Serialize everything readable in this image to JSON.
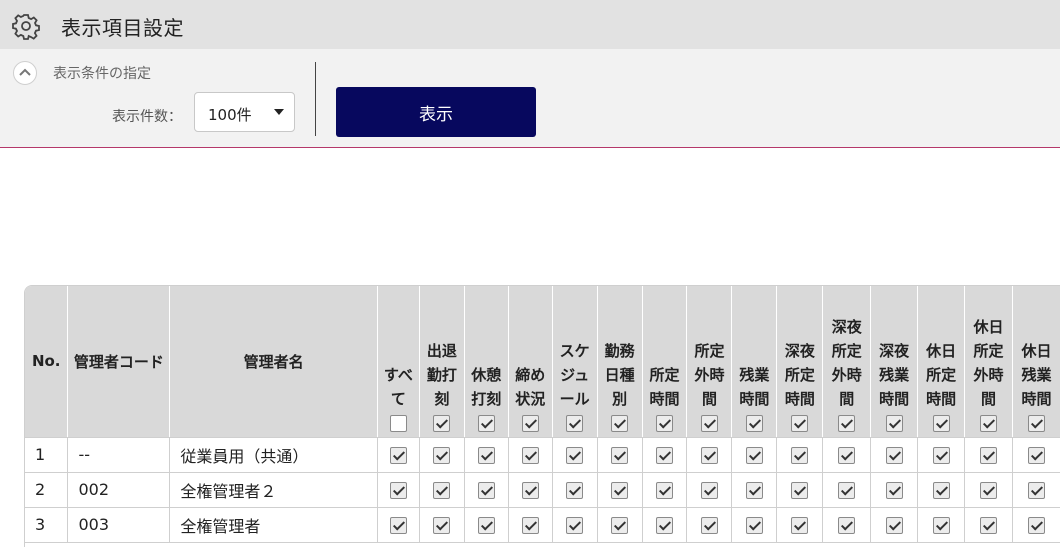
{
  "header": {
    "title": "表示項目設定",
    "icon": "gear-icon"
  },
  "conditions": {
    "title": "表示条件の指定",
    "count_label": "表示件数：",
    "count_value": "100件",
    "show_button": "表示"
  },
  "table": {
    "col_no": "No.",
    "col_code": "管理者コード",
    "col_name": "管理者名",
    "check_columns": [
      {
        "lines": [
          "すべ",
          "て"
        ],
        "header_checked": false
      },
      {
        "lines": [
          "出退",
          "勤打",
          "刻"
        ],
        "header_checked": true
      },
      {
        "lines": [
          "休憩",
          "打刻"
        ],
        "header_checked": true
      },
      {
        "lines": [
          "締め",
          "状況"
        ],
        "header_checked": true
      },
      {
        "lines": [
          "スケ",
          "ジュ",
          "ール"
        ],
        "header_checked": true
      },
      {
        "lines": [
          "勤務",
          "日種",
          "別"
        ],
        "header_checked": true
      },
      {
        "lines": [
          "所定",
          "時間"
        ],
        "header_checked": true
      },
      {
        "lines": [
          "所定",
          "外時",
          "間"
        ],
        "header_checked": true
      },
      {
        "lines": [
          "残業",
          "時間"
        ],
        "header_checked": true
      },
      {
        "lines": [
          "深夜",
          "所定",
          "時間"
        ],
        "header_checked": true
      },
      {
        "lines": [
          "深夜",
          "所定",
          "外時",
          "間"
        ],
        "header_checked": true
      },
      {
        "lines": [
          "深夜",
          "残業",
          "時間"
        ],
        "header_checked": true
      },
      {
        "lines": [
          "休日",
          "所定",
          "時間"
        ],
        "header_checked": true
      },
      {
        "lines": [
          "休日",
          "所定",
          "外時",
          "間"
        ],
        "header_checked": true
      },
      {
        "lines": [
          "休日",
          "残業",
          "時間"
        ],
        "header_checked": true
      }
    ],
    "rows": [
      {
        "no": "1",
        "code": "--",
        "name": "従業員用（共通）",
        "checks": [
          true,
          true,
          true,
          true,
          true,
          true,
          true,
          true,
          true,
          true,
          true,
          true,
          true,
          true,
          true
        ]
      },
      {
        "no": "2",
        "code": "002",
        "name": "全権管理者２",
        "checks": [
          true,
          true,
          true,
          true,
          true,
          true,
          true,
          true,
          true,
          true,
          true,
          true,
          true,
          true,
          true
        ]
      },
      {
        "no": "3",
        "code": "003",
        "name": "全権管理者",
        "checks": [
          true,
          true,
          true,
          true,
          true,
          true,
          true,
          true,
          true,
          true,
          true,
          true,
          true,
          true,
          true
        ]
      }
    ]
  }
}
